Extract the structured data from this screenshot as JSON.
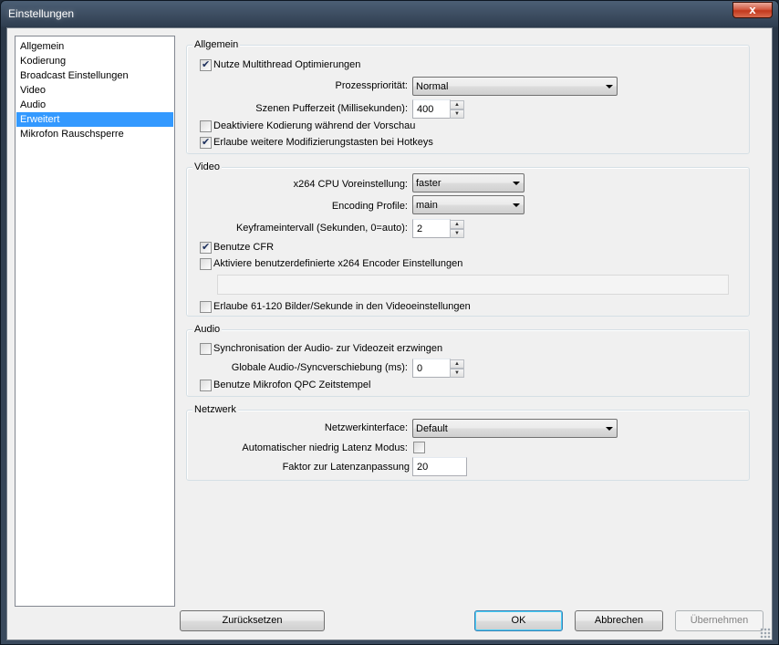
{
  "window": {
    "title": "Einstellungen",
    "close_glyph": "x"
  },
  "nav": {
    "items": [
      {
        "label": "Allgemein",
        "selected": false
      },
      {
        "label": "Kodierung",
        "selected": false
      },
      {
        "label": "Broadcast Einstellungen",
        "selected": false
      },
      {
        "label": "Video",
        "selected": false
      },
      {
        "label": "Audio",
        "selected": false
      },
      {
        "label": "Erweitert",
        "selected": true
      },
      {
        "label": "Mikrofon Rauschsperre",
        "selected": false
      }
    ]
  },
  "general": {
    "title": "Allgemein",
    "multithread": {
      "label": "Nutze Multithread Optimierungen",
      "checked": true
    },
    "priority": {
      "label": "Prozesspriorität:",
      "value": "Normal"
    },
    "buffer": {
      "label": "Szenen Pufferzeit (Millisekunden):",
      "value": "400"
    },
    "disable_preview_encoding": {
      "label": "Deaktiviere Kodierung während der Vorschau",
      "checked": false
    },
    "hotkey_modifiers": {
      "label": "Erlaube weitere Modifizierungstasten bei Hotkeys",
      "checked": true
    }
  },
  "video": {
    "title": "Video",
    "x264_preset": {
      "label": "x264 CPU Voreinstellung:",
      "value": "faster"
    },
    "encoding_profile": {
      "label": "Encoding Profile:",
      "value": "main"
    },
    "keyframe": {
      "label": "Keyframeintervall (Sekunden, 0=auto):",
      "value": "2"
    },
    "cfr": {
      "label": "Benutze CFR",
      "checked": true
    },
    "custom_x264": {
      "label": "Aktiviere benutzerdefinierte x264 Encoder Einstellungen",
      "checked": false,
      "value": ""
    },
    "high_fps": {
      "label": "Erlaube 61-120 Bilder/Sekunde in den Videoeinstellungen",
      "checked": false
    }
  },
  "audio": {
    "title": "Audio",
    "sync_force": {
      "label": "Synchronisation der Audio- zur Videozeit erzwingen",
      "checked": false
    },
    "global_offset": {
      "label": "Globale Audio-/Syncverschiebung (ms):",
      "value": "0"
    },
    "mic_qpc": {
      "label": "Benutze Mikrofon QPC Zeitstempel",
      "checked": false
    }
  },
  "network": {
    "title": "Netzwerk",
    "interface": {
      "label": "Netzwerkinterface:",
      "value": "Default"
    },
    "low_latency": {
      "label": "Automatischer niedrig Latenz Modus:",
      "checked": false
    },
    "latency_factor": {
      "label": "Faktor zur Latenzanpassung",
      "value": "20"
    }
  },
  "buttons": {
    "reset": "Zurücksetzen",
    "ok": "OK",
    "cancel": "Abbrechen",
    "apply": "Übernehmen"
  },
  "colors": {
    "selection": "#3399ff",
    "close_button": "#c2391c"
  }
}
